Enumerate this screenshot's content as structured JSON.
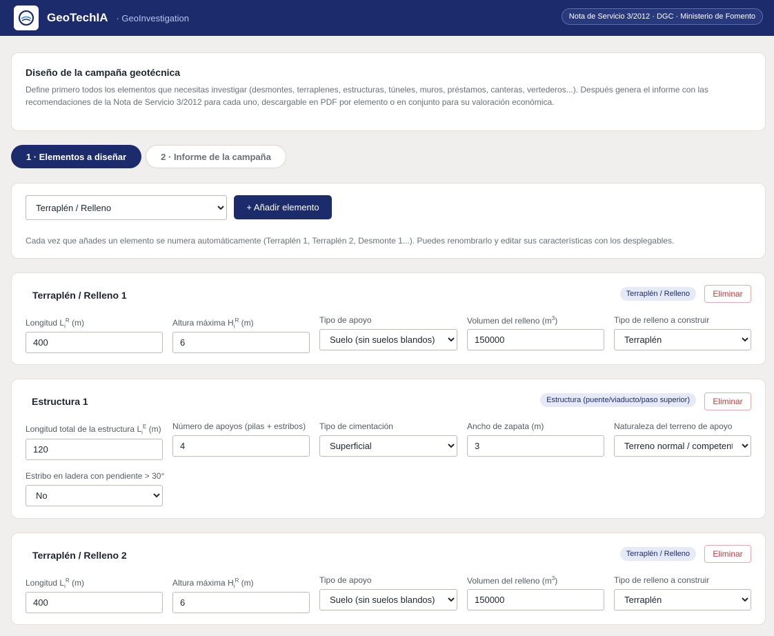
{
  "header": {
    "app_name": "GeoTechIA",
    "app_sub": "· GeoInvestigation",
    "badge": "Nota de Servicio 3/2012 · DGC · Ministerio de Fomento",
    "logo_icon": "geo-logo-icon"
  },
  "intro": {
    "title": "Diseño de la campaña geotécnica",
    "text": "Define primero todos los elementos que necesitas investigar (desmontes, terraplenes, estructuras, túneles, muros, préstamos, canteras, vertederos...). Después genera el informe con las recomendaciones de la Nota de Servicio 3/2012 para cada uno, descargable en PDF por elemento o en conjunto para su valoración económica."
  },
  "tabs": [
    {
      "label": "1 · Elementos a diseñar",
      "active": true
    },
    {
      "label": "2 · Informe de la campaña",
      "active": false
    }
  ],
  "adder": {
    "selected_type": "Terraplén / Relleno",
    "add_label": "+ Añadir elemento",
    "hint": "Cada vez que añades un elemento se numera automáticamente (Terraplén 1, Terraplén 2, Desmonte 1...). Puedes renombrarlo y editar sus características con los desplegables."
  },
  "delete_label": "Eliminar",
  "elements": [
    {
      "title": "Terraplén / Relleno 1",
      "type_badge": "Terraplén / Relleno",
      "fields": [
        {
          "label_main": "Longitud L",
          "label_sub": "i",
          "label_sup": "R",
          "label_tail": " (m)",
          "value": "400"
        },
        {
          "label_main": "Altura máxima H",
          "label_sub": "i",
          "label_sup": "R",
          "label_tail": " (m)",
          "value": "6"
        },
        {
          "label_main": "Tipo de apoyo",
          "value": "Suelo (sin suelos blandos)"
        },
        {
          "label_main": "Volumen del relleno (m",
          "label_sup": "3",
          "label_tail": ")",
          "value": "150000"
        },
        {
          "label_main": "Tipo de relleno a construir",
          "value": "Terraplén"
        }
      ]
    },
    {
      "title": "Estructura 1",
      "type_badge": "Estructura (puente/viaducto/paso superior)",
      "fields": [
        {
          "label_main": "Longitud total de la estructura L",
          "label_sub": "i",
          "label_sup": "E",
          "label_tail": " (m)",
          "value": "120"
        },
        {
          "label_main": "Número de apoyos (pilas + estribos)",
          "value": "4"
        },
        {
          "label_main": "Tipo de cimentación",
          "value": "Superficial"
        },
        {
          "label_main": "Ancho de zapata (m)",
          "value": "3"
        },
        {
          "label_main": "Naturaleza del terreno de apoyo",
          "value": "Terreno normal / competente"
        },
        {
          "label_main": "Estribo en ladera con pendiente > 30°",
          "value": "No"
        }
      ]
    },
    {
      "title": "Terraplén / Relleno 2",
      "type_badge": "Terraplén / Relleno",
      "fields": [
        {
          "label_main": "Longitud L",
          "label_sub": "i",
          "label_sup": "R",
          "label_tail": " (m)",
          "value": "400"
        },
        {
          "label_main": "Altura máxima H",
          "label_sub": "i",
          "label_sup": "R",
          "label_tail": " (m)",
          "value": "6"
        },
        {
          "label_main": "Tipo de apoyo",
          "value": "Suelo (sin suelos blandos)"
        },
        {
          "label_main": "Volumen del relleno (m",
          "label_sup": "3",
          "label_tail": ")",
          "value": "150000"
        },
        {
          "label_main": "Tipo de relleno a construir",
          "value": "Terraplén"
        }
      ]
    }
  ]
}
